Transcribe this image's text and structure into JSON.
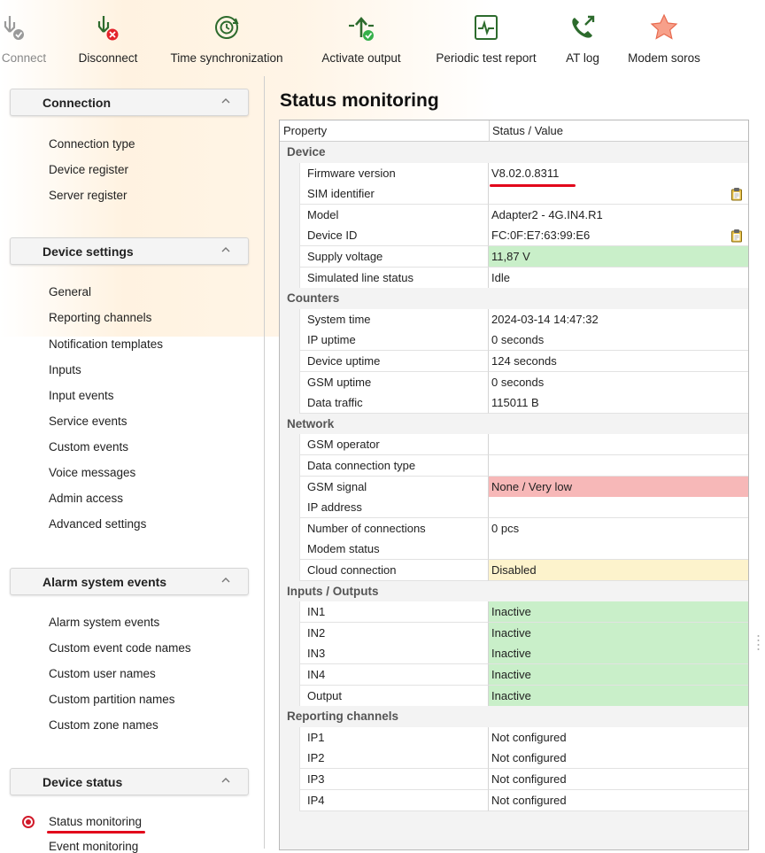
{
  "toolbar": {
    "buttons": [
      {
        "label": "Connect",
        "icon": "usb-connect-icon"
      },
      {
        "label": "Disconnect",
        "icon": "usb-disconnect-icon"
      },
      {
        "label": "Time synchronization",
        "icon": "clock-sync-icon"
      },
      {
        "label": "Activate output",
        "icon": "activate-output-icon"
      },
      {
        "label": "Periodic test report",
        "icon": "pulse-report-icon"
      },
      {
        "label": "AT log",
        "icon": "phone-log-icon"
      },
      {
        "label": "Modem soros",
        "icon": "star-icon"
      }
    ]
  },
  "sidebar": {
    "sections": [
      {
        "title": "Connection",
        "items": [
          "Connection type",
          "Device register",
          "Server register"
        ]
      },
      {
        "title": "Device settings",
        "items": [
          "General",
          "Reporting channels",
          "Notification templates",
          "Inputs",
          "Input events",
          "Service events",
          "Custom events",
          "Voice messages",
          "Admin access",
          "Advanced settings"
        ]
      },
      {
        "title": "Alarm system events",
        "items": [
          "Alarm system events",
          "Custom event code names",
          "Custom user names",
          "Custom partition names",
          "Custom zone names"
        ]
      },
      {
        "title": "Device status",
        "items": [
          "Status monitoring",
          "Event monitoring"
        ]
      }
    ],
    "selected": "Status monitoring"
  },
  "main": {
    "title": "Status monitoring",
    "columns": [
      "Property",
      "Status / Value"
    ],
    "groups": [
      {
        "name": "Device",
        "rows": [
          {
            "property": "Firmware version",
            "value": "V8.02.0.8311",
            "status": "normal"
          },
          {
            "property": "SIM identifier",
            "value": "",
            "status": "normal",
            "copy": true
          },
          {
            "property": "Model",
            "value": "Adapter2 - 4G.IN4.R1",
            "status": "normal"
          },
          {
            "property": "Device ID",
            "value": "FC:0F:E7:63:99:E6",
            "status": "normal",
            "copy": true
          },
          {
            "property": "Supply voltage",
            "value": "11,87 V",
            "status": "ok"
          },
          {
            "property": "Simulated line status",
            "value": "Idle",
            "status": "normal"
          }
        ]
      },
      {
        "name": "Counters",
        "rows": [
          {
            "property": "System time",
            "value": "2024-03-14 14:47:32",
            "status": "normal"
          },
          {
            "property": "IP uptime",
            "value": "0 seconds",
            "status": "normal"
          },
          {
            "property": "Device uptime",
            "value": "124 seconds",
            "status": "normal"
          },
          {
            "property": "GSM uptime",
            "value": "0 seconds",
            "status": "normal"
          },
          {
            "property": "Data traffic",
            "value": "115011 B",
            "status": "normal"
          }
        ]
      },
      {
        "name": "Network",
        "rows": [
          {
            "property": "GSM operator",
            "value": "",
            "status": "normal"
          },
          {
            "property": "Data connection type",
            "value": "",
            "status": "normal"
          },
          {
            "property": "GSM signal",
            "value": "None / Very low",
            "status": "error"
          },
          {
            "property": "IP address",
            "value": "",
            "status": "normal"
          },
          {
            "property": "Number of connections",
            "value": "0 pcs",
            "status": "normal"
          },
          {
            "property": "Modem status",
            "value": "",
            "status": "normal"
          },
          {
            "property": "Cloud connection",
            "value": "Disabled",
            "status": "warning"
          }
        ]
      },
      {
        "name": "Inputs / Outputs",
        "rows": [
          {
            "property": "IN1",
            "value": "Inactive",
            "status": "ok"
          },
          {
            "property": "IN2",
            "value": "Inactive",
            "status": "ok"
          },
          {
            "property": "IN3",
            "value": "Inactive",
            "status": "ok"
          },
          {
            "property": "IN4",
            "value": "Inactive",
            "status": "ok"
          },
          {
            "property": "Output",
            "value": "Inactive",
            "status": "ok"
          }
        ]
      },
      {
        "name": "Reporting channels",
        "rows": [
          {
            "property": "IP1",
            "value": "Not configured",
            "status": "normal"
          },
          {
            "property": "IP2",
            "value": "Not configured",
            "status": "normal"
          },
          {
            "property": "IP3",
            "value": "Not configured",
            "status": "normal"
          },
          {
            "property": "IP4",
            "value": "Not configured",
            "status": "normal"
          }
        ]
      }
    ]
  },
  "colors": {
    "ok": "#c9efc9",
    "error": "#f7b8b8",
    "warning": "#fdf3cc",
    "accent": "#e2061b"
  }
}
